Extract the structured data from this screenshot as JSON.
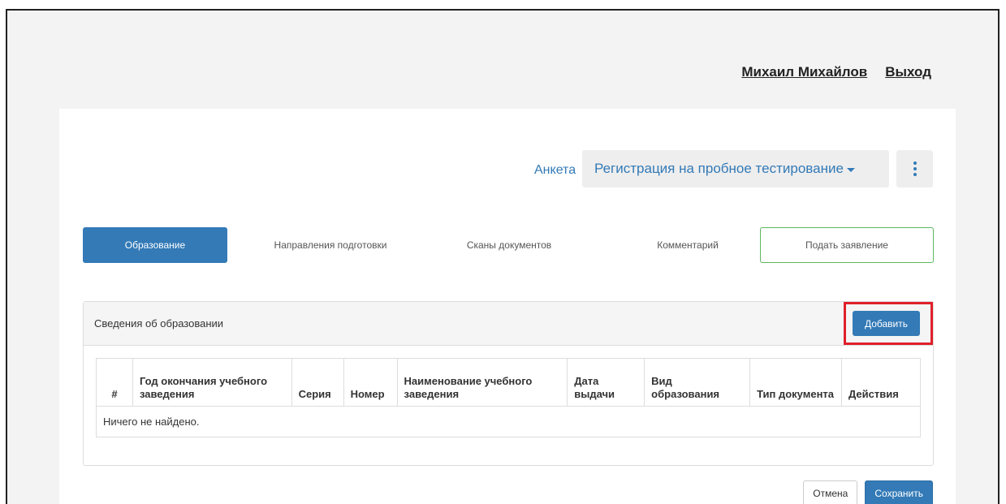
{
  "header": {
    "user_name": "Михаил Михайлов",
    "logout": "Выход"
  },
  "toolbar": {
    "anketa_link": "Анкета",
    "registration_dropdown": "Регистрация на пробное тестирование",
    "more_icon": "vertical-ellipsis-icon"
  },
  "tabs": [
    {
      "label": "Образование",
      "state": "active"
    },
    {
      "label": "Направления подготовки",
      "state": "normal"
    },
    {
      "label": "Сканы документов",
      "state": "normal"
    },
    {
      "label": "Комментарий",
      "state": "normal"
    },
    {
      "label": "Подать заявление",
      "state": "outlined"
    }
  ],
  "panel": {
    "title": "Сведения об образовании",
    "add_button": "Добавить",
    "table": {
      "columns": [
        "#",
        "Год окончания учебного заведения",
        "Серия",
        "Номер",
        "Наименование учебного заведения",
        "Дата выдачи",
        "Вид образования",
        "Тип документа",
        "Действия"
      ],
      "empty_message": "Ничего не найдено."
    }
  },
  "footer": {
    "cancel": "Отмена",
    "save": "Сохранить"
  },
  "colors": {
    "primary": "#337ab7",
    "success_outline": "#5cb85c",
    "highlight": "#e0202a"
  }
}
